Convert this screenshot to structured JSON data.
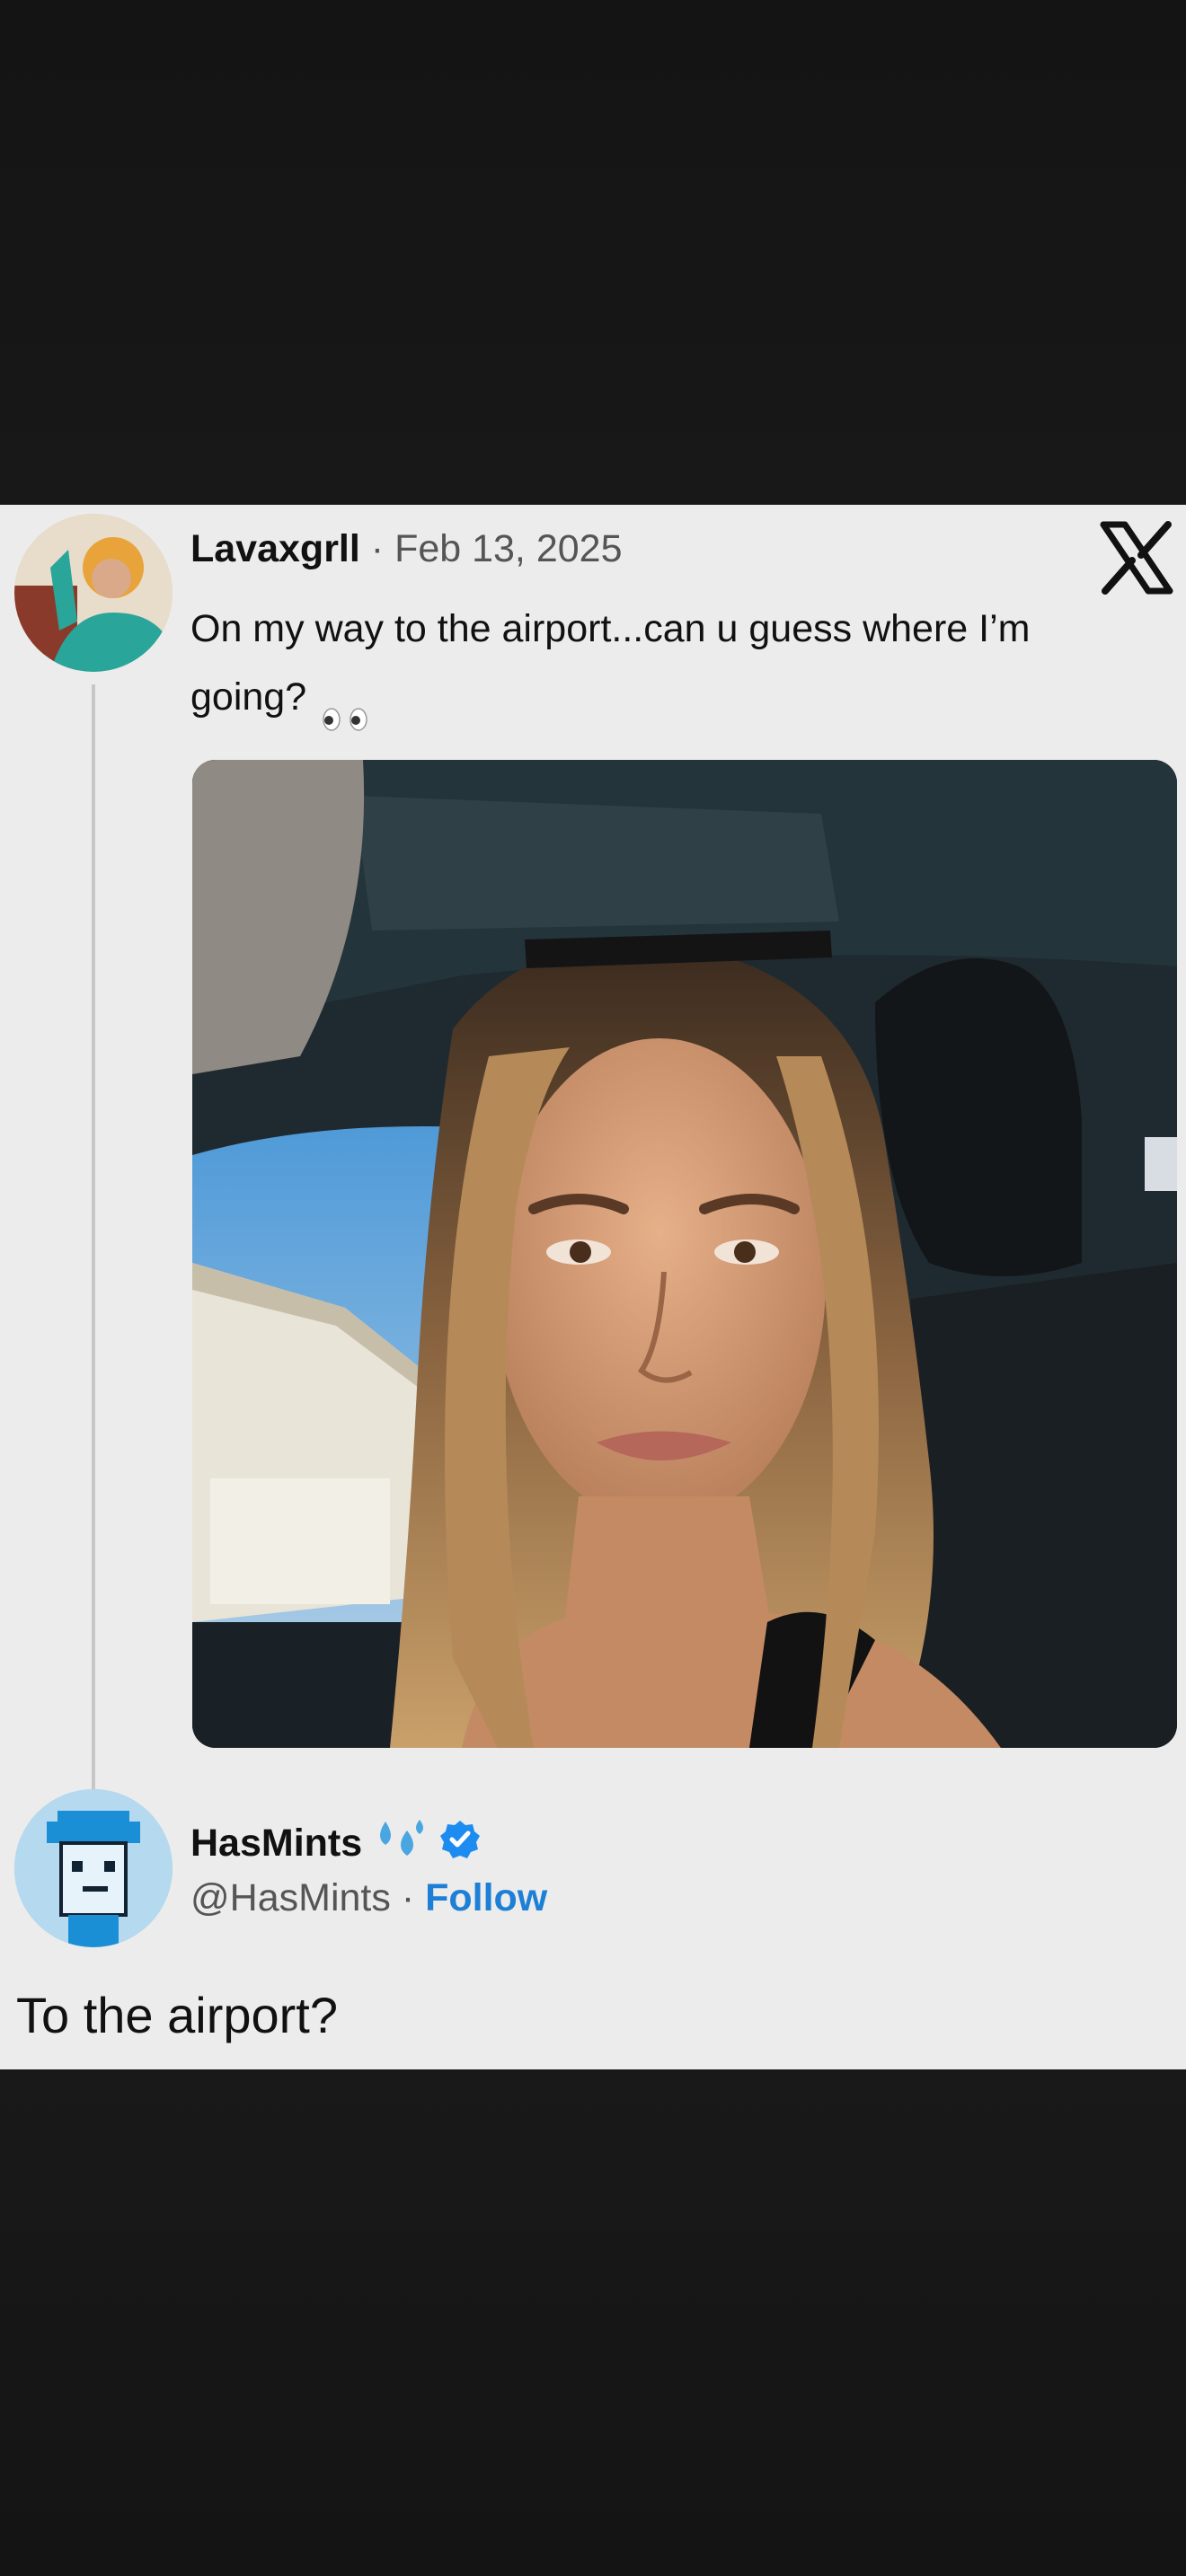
{
  "post": {
    "author": "Lavaxgrll",
    "separator": "·",
    "date": "Feb 13, 2025",
    "text": "On my way to the airport...can u guess where I’m going?",
    "emoji_icon": "eyes-emoji-icon",
    "platform_icon": "x-logo-icon"
  },
  "reply": {
    "author": "HasMints",
    "author_emoji_icon": "sweat-droplets-icon",
    "verified_icon": "verified-badge-icon",
    "handle": "@HasMints",
    "separator": "·",
    "follow_label": "Follow",
    "text": "To the airport?"
  },
  "colors": {
    "card_background": "#ececec",
    "follow_link": "#1d7fd6",
    "verified_badge": "#1d8cf0",
    "page_background": "#1a1a1a"
  }
}
